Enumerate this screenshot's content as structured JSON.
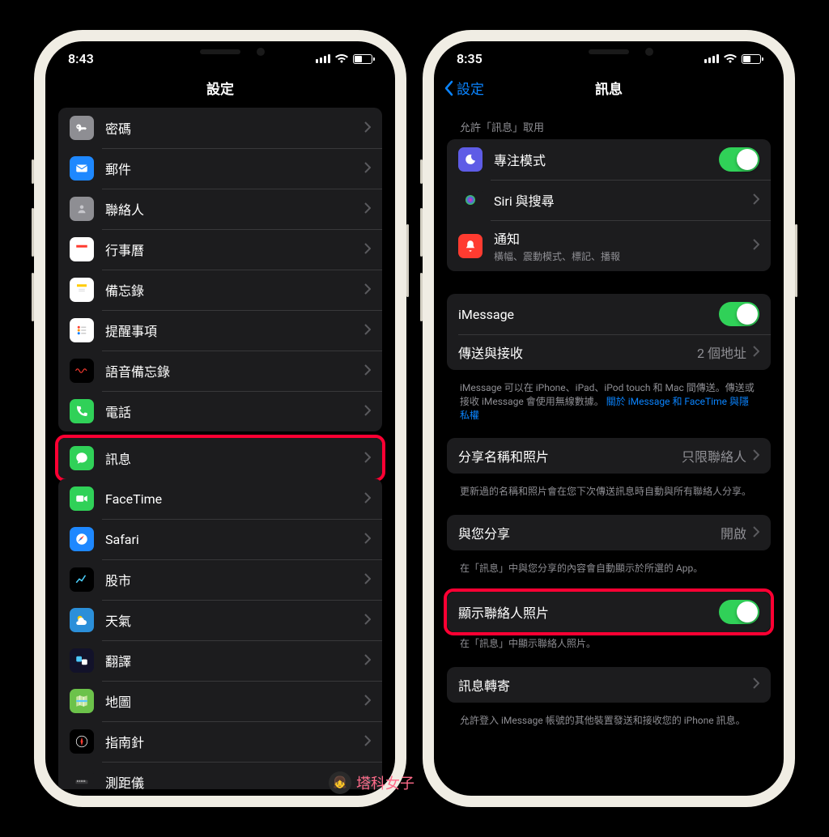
{
  "left": {
    "time": "8:43",
    "title": "設定",
    "items": [
      {
        "id": "passwords",
        "label": "密碼",
        "color": "#8e8e93"
      },
      {
        "id": "mail",
        "label": "郵件",
        "color": "#1e88ff"
      },
      {
        "id": "contacts",
        "label": "聯絡人",
        "color": "#8e8e93"
      },
      {
        "id": "calendar",
        "label": "行事曆",
        "color": "#fff"
      },
      {
        "id": "notes",
        "label": "備忘錄",
        "color": "#fff"
      },
      {
        "id": "reminders",
        "label": "提醒事項",
        "color": "#fff"
      },
      {
        "id": "voicememos",
        "label": "語音備忘錄",
        "color": "#000"
      },
      {
        "id": "phone",
        "label": "電話",
        "color": "#30d158"
      },
      {
        "id": "messages",
        "label": "訊息",
        "color": "#30d158",
        "highlight": true
      },
      {
        "id": "facetime",
        "label": "FaceTime",
        "color": "#30d158"
      },
      {
        "id": "safari",
        "label": "Safari",
        "color": "#1e88ff"
      },
      {
        "id": "stocks",
        "label": "股市",
        "color": "#000"
      },
      {
        "id": "weather",
        "label": "天氣",
        "color": "#2b8fd9"
      },
      {
        "id": "translate",
        "label": "翻譯",
        "color": "#12122a"
      },
      {
        "id": "maps",
        "label": "地圖",
        "color": "#6cc24a"
      },
      {
        "id": "compass",
        "label": "指南針",
        "color": "#000"
      },
      {
        "id": "measure",
        "label": "測距儀",
        "color": "#1c1c1e"
      }
    ]
  },
  "right": {
    "time": "8:35",
    "back": "設定",
    "title": "訊息",
    "allow_header": "允許「訊息」取用",
    "group1": [
      {
        "id": "focus",
        "label": "專注模式",
        "color": "#5e5ce6",
        "toggle": true
      },
      {
        "id": "siri",
        "label": "Siri 與搜尋",
        "color": "#1c1c1e",
        "chevron": true
      },
      {
        "id": "notifications",
        "label": "通知",
        "sub": "橫幅、震動模式、標記、播報",
        "color": "#ff3b30",
        "chevron": true
      }
    ],
    "group2": [
      {
        "id": "imessage",
        "label": "iMessage",
        "toggle": true
      },
      {
        "id": "sendrecv",
        "label": "傳送與接收",
        "value": "2 個地址",
        "chevron": true
      }
    ],
    "footer2_a": "iMessage 可以在 iPhone、iPad、iPod touch 和 Mac 間傳送。傳送或接收 iMessage 會使用無線數據。",
    "footer2_b": "關於 iMessage 和 FaceTime 與隱私權",
    "group3": [
      {
        "id": "sharename",
        "label": "分享名稱和照片",
        "value": "只限聯絡人",
        "chevron": true
      }
    ],
    "footer3": "更新過的名稱和照片會在您下次傳送訊息時自動與所有聯絡人分享。",
    "group4": [
      {
        "id": "shared",
        "label": "與您分享",
        "value": "開啟",
        "chevron": true
      }
    ],
    "footer4": "在「訊息」中與您分享的內容會自動顯示於所選的 App。",
    "group5": [
      {
        "id": "showphotos",
        "label": "顯示聯絡人照片",
        "toggle": true,
        "highlight": true
      }
    ],
    "footer5": "在「訊息」中顯示聯絡人照片。",
    "group6": [
      {
        "id": "forward",
        "label": "訊息轉寄",
        "chevron": true
      }
    ],
    "footer6": "允許登入 iMessage 帳號的其他裝置發送和接收您的 iPhone 訊息。"
  },
  "watermark": "塔科女子"
}
